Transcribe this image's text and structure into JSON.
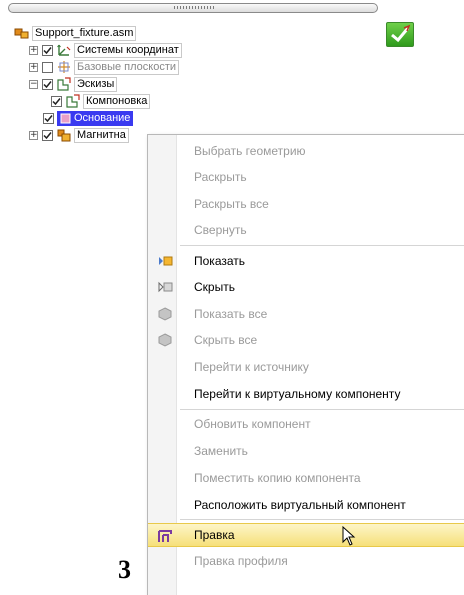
{
  "tree": {
    "root": "Support_fixture.asm",
    "items": [
      {
        "label": "Системы координат",
        "expand": "+",
        "checked": true
      },
      {
        "label": "Базовые плоскости",
        "expand": "+",
        "checked": false
      },
      {
        "label": "Эскизы",
        "expand": "−",
        "checked": true
      },
      {
        "label": "Компоновка",
        "checked": true
      },
      {
        "label": "Основание",
        "checked": true,
        "selected": true
      },
      {
        "label": "Магнитна",
        "expand": "+",
        "checked": true
      }
    ]
  },
  "context_menu": {
    "items": [
      {
        "label": "Выбрать геометрию",
        "enabled": false
      },
      {
        "label": "Раскрыть",
        "enabled": false
      },
      {
        "label": "Раскрыть все",
        "enabled": false
      },
      {
        "label": "Свернуть",
        "enabled": false
      },
      {
        "label": "Показать",
        "enabled": true,
        "icon": "show-icon"
      },
      {
        "label": "Скрыть",
        "enabled": true,
        "icon": "hide-icon"
      },
      {
        "label": "Показать все",
        "enabled": false,
        "icon": "show-all-icon"
      },
      {
        "label": "Скрыть все",
        "enabled": false,
        "icon": "hide-all-icon"
      },
      {
        "label": "Перейти к источнику",
        "enabled": false
      },
      {
        "label": "Перейти к виртуальному компоненту",
        "enabled": true
      },
      {
        "label": "Обновить компонент",
        "enabled": false
      },
      {
        "label": "Заменить",
        "enabled": false
      },
      {
        "label": "Поместить копию компонента",
        "enabled": false
      },
      {
        "label": "Расположить виртуальный компонент",
        "enabled": true
      },
      {
        "label": "Правка",
        "enabled": true,
        "highlighted": true,
        "icon": "edit-icon"
      },
      {
        "label": "Правка профиля",
        "enabled": false
      }
    ]
  },
  "annotation_digit": "3",
  "colors": {
    "selection": "#3a3af0",
    "highlight": "#f6e07a",
    "disabled_text": "#9a9a9a"
  }
}
